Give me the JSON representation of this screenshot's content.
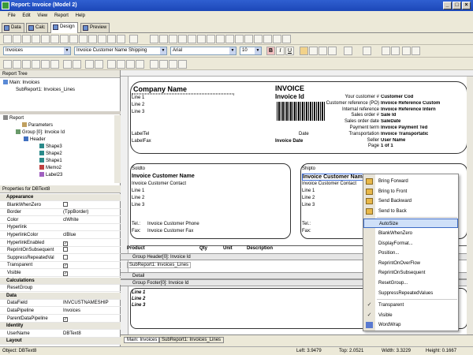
{
  "window": {
    "title": "Report: Invoice (Model 2)"
  },
  "menu": [
    "File",
    "Edit",
    "View",
    "Report",
    "Help"
  ],
  "tabs": [
    "Data",
    "Calc",
    "Design",
    "Preview"
  ],
  "toolbar": {
    "band_combo": "Invoices",
    "field_combo": "Invoice Customer Name Shipping",
    "font_combo": "Arial",
    "size_combo": "10"
  },
  "report_tree": {
    "title": "Report Tree",
    "items": [
      "Main: Invoices",
      "SubReport1: Invoices_Lines"
    ]
  },
  "object_tree": {
    "items": [
      "Report",
      "Parameters",
      "Group [0]: Invoice Id",
      "Header",
      "Shape3",
      "Shape2",
      "Shape1",
      "Memo2",
      "Label23"
    ]
  },
  "properties": {
    "title": "Properties for DBText8",
    "rows": [
      {
        "type": "cat",
        "k": "Appearance"
      },
      {
        "k": "BlankWhenZero",
        "check": false
      },
      {
        "k": "Border",
        "v": "(TppBorder)"
      },
      {
        "k": "Color",
        "v": "clWhite"
      },
      {
        "k": "Hyperlink",
        "v": ""
      },
      {
        "k": "HyperlinkColor",
        "v": "clBlue"
      },
      {
        "k": "HyperlinkEnabled",
        "check": true
      },
      {
        "k": "ReprintOnSubsequent",
        "check": false
      },
      {
        "k": "SuppressRepeatedVal",
        "check": false
      },
      {
        "k": "Transparent",
        "check": true
      },
      {
        "k": "Visible",
        "check": true
      },
      {
        "type": "cat",
        "k": "Calculations"
      },
      {
        "k": "ResetGroup",
        "v": ""
      },
      {
        "type": "cat",
        "k": "Data"
      },
      {
        "k": "DataField",
        "v": "INVCUSTNAMESHIP"
      },
      {
        "k": "DataPipeline",
        "v": "Invoices"
      },
      {
        "k": "ParentDataPipeline",
        "check": true
      },
      {
        "type": "cat",
        "k": "Identity"
      },
      {
        "k": "UserName",
        "v": "DBText8"
      },
      {
        "type": "cat",
        "k": "Layout"
      }
    ]
  },
  "design": {
    "company": "Company Name",
    "invoice_title": "INVOICE",
    "invoice_id": "Invoice Id",
    "lines": [
      "Line 1",
      "Line 2",
      "Line 3"
    ],
    "label_tel": "LabelTel",
    "label_fax": "LabelFax",
    "date_label": "Date",
    "invoice_date": "Invoice Date",
    "right_labels": [
      "Your customer #",
      "Customer reference (PO)",
      "Internal reference",
      "Sales order #",
      "Sales order date",
      "Payment term",
      "Transportation",
      "Seller",
      "Page"
    ],
    "right_values": [
      "Customer Cod",
      "Invoice Reference Custom",
      "Invoice Reference Intern",
      "Sale Id",
      "SaleDate",
      "Invoice Payment Ted",
      "Invoice Transportatic",
      "User Name",
      "1 of 1"
    ],
    "soldto": "Soldto",
    "shipto": "Shipto",
    "cust_name": "Invoice Customer Name",
    "cust_contact": "Invoice Customer Contact",
    "tel_label": "Tel.:",
    "fax_label": "Fax:",
    "cust_phone": "Invoice Customer Phone",
    "cust_fax": "Invoice Customer Fax",
    "columns": [
      "Product",
      "Qty",
      "Unit",
      "Description"
    ],
    "band_group_header": "Group Header[0]: Invoice Id",
    "subreport_label": "SubReport1: Invoices_Lines",
    "band_detail": "Detail",
    "band_group_footer": "Group Footer[0]: Invoice Id",
    "footer_lines": [
      "Line 1",
      "Line 2",
      "Line 3"
    ]
  },
  "context_menu": {
    "items": [
      "Bring Forward",
      "Bring to Front",
      "Send Backward",
      "Send to Back",
      "AutoSize",
      "BlankWhenZero",
      "DisplayFormat...",
      "Position...",
      "ReprintOnOverFlow",
      "ReprintOnSubsequent",
      "ResetGroup...",
      "SuppressRepeatedValues",
      "Transparent",
      "Visible",
      "WordWrap"
    ],
    "selected": "AutoSize"
  },
  "bottom_tabs": [
    "Main: Invoices",
    "SubReport1: Invoices_Lines"
  ],
  "status": {
    "object": "Object: DBText8",
    "left": "Left: 3.9479",
    "top": "Top: 2.0521",
    "width": "Width: 3.3229",
    "height": "Height: 0.1667"
  }
}
